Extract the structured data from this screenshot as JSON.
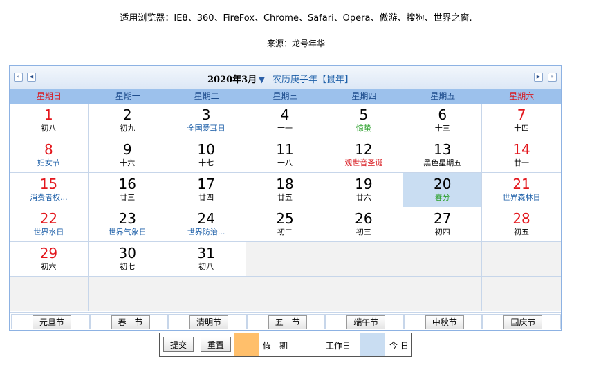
{
  "header": {
    "browsers": "适用浏览器：IE8、360、FireFox、Chrome、Safari、Opera、傲游、搜狗、世界之窗.",
    "source": "来源：龙号年华"
  },
  "calendar": {
    "month_label": "2020年3月",
    "lunar_year": "农历庚子年【鼠年】",
    "weekdays": [
      "星期日",
      "星期一",
      "星期二",
      "星期三",
      "星期四",
      "星期五",
      "星期六"
    ],
    "days": [
      {
        "day": "1",
        "sub": "初八",
        "sub_type": "plain"
      },
      {
        "day": "2",
        "sub": "初九",
        "sub_type": "plain"
      },
      {
        "day": "3",
        "sub": "全国爱耳日",
        "sub_type": "festival"
      },
      {
        "day": "4",
        "sub": "十一",
        "sub_type": "plain"
      },
      {
        "day": "5",
        "sub": "惊蛰",
        "sub_type": "term"
      },
      {
        "day": "6",
        "sub": "十三",
        "sub_type": "plain"
      },
      {
        "day": "7",
        "sub": "十四",
        "sub_type": "plain"
      },
      {
        "day": "8",
        "sub": "妇女节",
        "sub_type": "festival"
      },
      {
        "day": "9",
        "sub": "十六",
        "sub_type": "plain"
      },
      {
        "day": "10",
        "sub": "十七",
        "sub_type": "plain"
      },
      {
        "day": "11",
        "sub": "十八",
        "sub_type": "plain"
      },
      {
        "day": "12",
        "sub": "观世音圣诞",
        "sub_type": "buddha"
      },
      {
        "day": "13",
        "sub": "黑色星期五",
        "sub_type": "plain"
      },
      {
        "day": "14",
        "sub": "廿一",
        "sub_type": "plain"
      },
      {
        "day": "15",
        "sub": "消费者权...",
        "sub_type": "festival"
      },
      {
        "day": "16",
        "sub": "廿三",
        "sub_type": "plain"
      },
      {
        "day": "17",
        "sub": "廿四",
        "sub_type": "plain"
      },
      {
        "day": "18",
        "sub": "廿五",
        "sub_type": "plain"
      },
      {
        "day": "19",
        "sub": "廿六",
        "sub_type": "plain"
      },
      {
        "day": "20",
        "sub": "春分",
        "sub_type": "term",
        "today": true
      },
      {
        "day": "21",
        "sub": "世界森林日",
        "sub_type": "festival"
      },
      {
        "day": "22",
        "sub": "世界水日",
        "sub_type": "festival"
      },
      {
        "day": "23",
        "sub": "世界气象日",
        "sub_type": "festival"
      },
      {
        "day": "24",
        "sub": "世界防治...",
        "sub_type": "festival"
      },
      {
        "day": "25",
        "sub": "初二",
        "sub_type": "plain"
      },
      {
        "day": "26",
        "sub": "初三",
        "sub_type": "plain"
      },
      {
        "day": "27",
        "sub": "初四",
        "sub_type": "plain"
      },
      {
        "day": "28",
        "sub": "初五",
        "sub_type": "plain"
      },
      {
        "day": "29",
        "sub": "初六",
        "sub_type": "plain"
      },
      {
        "day": "30",
        "sub": "初七",
        "sub_type": "plain"
      },
      {
        "day": "31",
        "sub": "初八",
        "sub_type": "plain"
      }
    ],
    "holidays": [
      "元旦节",
      "春　节",
      "清明节",
      "五一节",
      "端午节",
      "中秋节",
      "国庆节"
    ]
  },
  "legend": {
    "submit": "提交",
    "reset": "重置",
    "holiday_label": "假　期",
    "workday_label": "工作日",
    "today_label": "今 日",
    "holiday_color": "#ffbf6b",
    "today_color": "#c9ddf2"
  },
  "colors": {
    "weekend_red": "#e3161c",
    "festival_blue": "#1d5fa8",
    "term_green": "#2ea12e",
    "weekday_bar": "#9cc1ec"
  }
}
